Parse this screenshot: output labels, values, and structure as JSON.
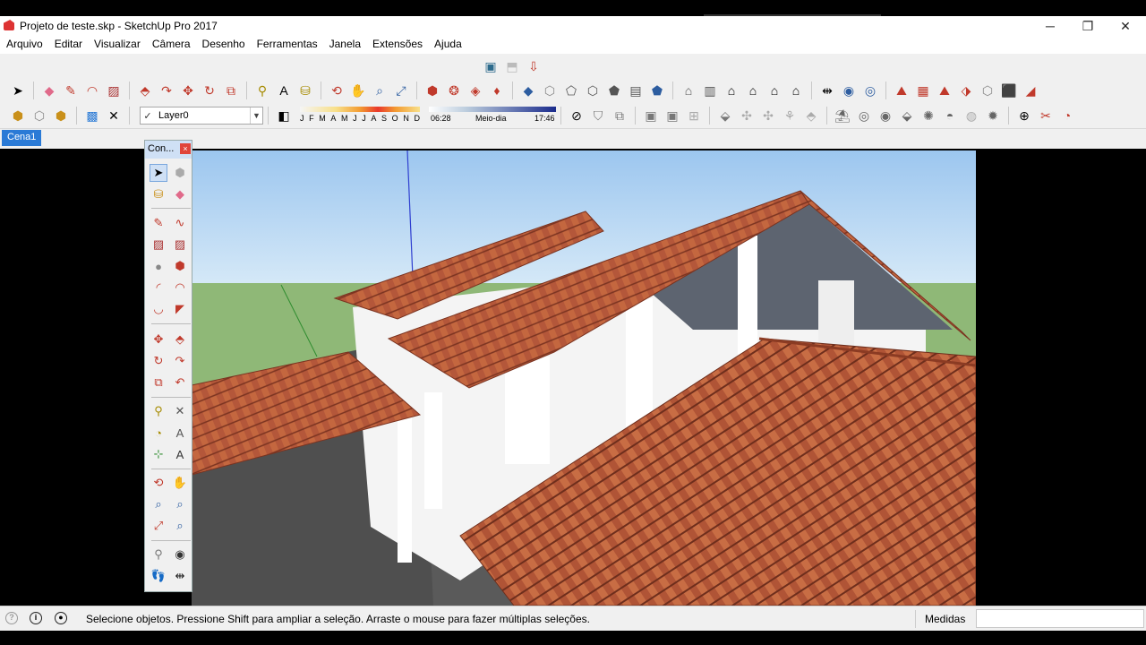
{
  "window": {
    "title": "Projeto de teste.skp - SketchUp Pro 2017",
    "minimize_glyph": "─",
    "restore_glyph": "❐",
    "close_glyph": "✕"
  },
  "menu": [
    "Arquivo",
    "Editar",
    "Visualizar",
    "Câmera",
    "Desenho",
    "Ferramentas",
    "Janela",
    "Extensões",
    "Ajuda"
  ],
  "toolbar": {
    "layer_check": "✓",
    "layer_name": "Layer0",
    "layer_arrow": "▼",
    "months": [
      "J",
      "F",
      "M",
      "A",
      "M",
      "J",
      "J",
      "A",
      "S",
      "O",
      "N",
      "D"
    ],
    "time_start": "06:28",
    "time_mid": "Meio-dia",
    "time_end": "17:46"
  },
  "scenes": {
    "active_tab": "Cena1"
  },
  "instructor_panel": {
    "title": "Con...",
    "close": "×"
  },
  "status": {
    "hint": "Selecione objetos. Pressione Shift para ampliar a seleção. Arraste o mouse para fazer múltiplas seleções.",
    "measurements_label": "Medidas",
    "measurements_value": "",
    "info_glyph": "i"
  },
  "colors": {
    "sky": "#b8d8f5",
    "ground": "#8fb877",
    "roof_tile": "#b4573a",
    "wall": "#f7f7f7",
    "accent": "#2a7ad6"
  }
}
